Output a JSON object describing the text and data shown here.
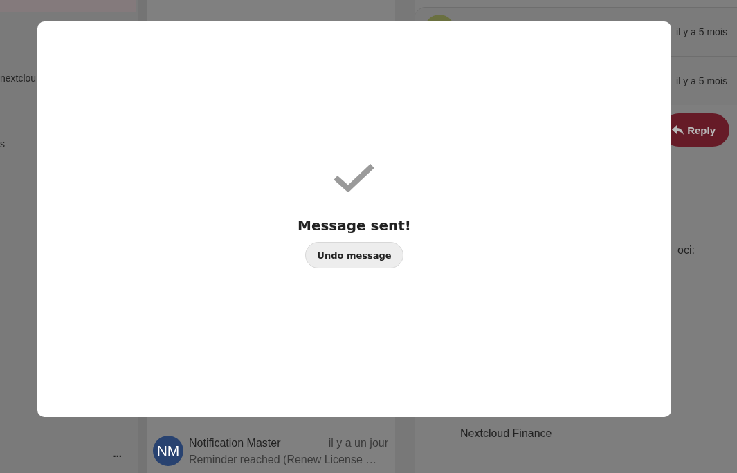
{
  "navigation": {
    "items": [
      {
        "label": "nextclou"
      },
      {
        "label": "s"
      }
    ],
    "more_label": "..."
  },
  "message_list": {
    "items": [
      {
        "initials": "NM",
        "sender": "Notification Master",
        "time": "il y a un jour",
        "preview": "Reminder reached (Renew License …",
        "color": "#284270"
      }
    ]
  },
  "thread": {
    "messages": [
      {
        "time": "il y a 5 mois"
      },
      {
        "time": "il y a 5 mois"
      }
    ],
    "reply_button": "Reply",
    "body_lines": [
      "oci:",
      "Nextcloud Finance"
    ]
  },
  "dialog": {
    "title": "Message sent!",
    "undo_button": "Undo message"
  }
}
